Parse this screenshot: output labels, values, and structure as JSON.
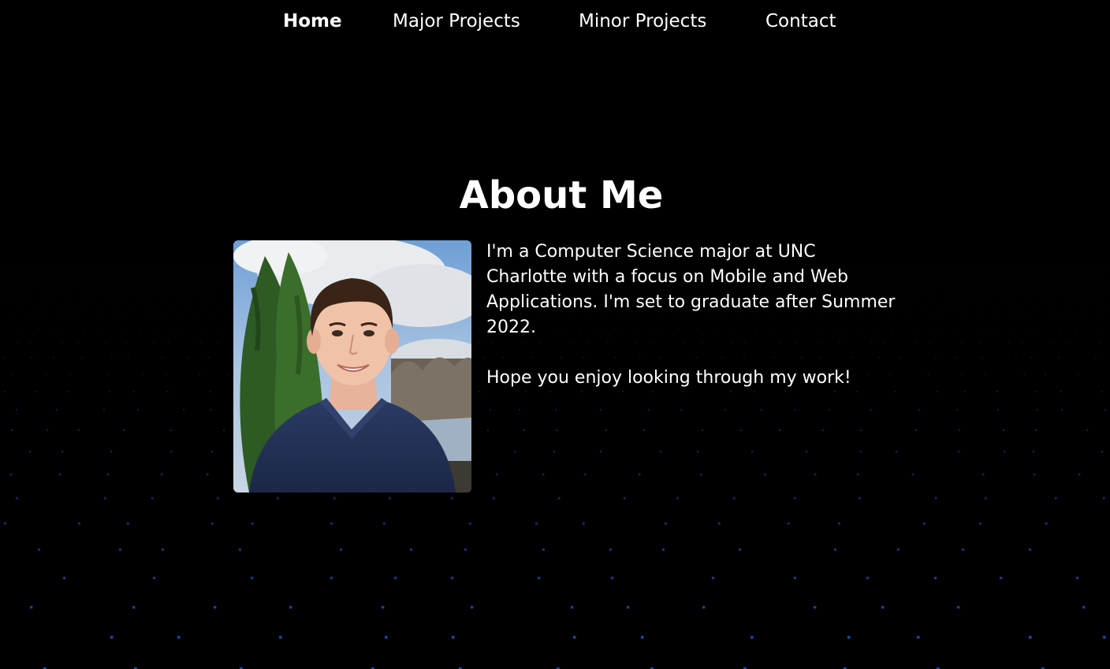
{
  "nav": {
    "items": [
      {
        "label": "Home",
        "active": true
      },
      {
        "label": "Major Projects",
        "active": false
      },
      {
        "label": "Minor Projects",
        "active": false
      },
      {
        "label": "Contact",
        "active": false
      }
    ]
  },
  "about": {
    "title": "About Me",
    "paragraphs": [
      "I'm a Computer Science major at UNC Charlotte with a focus on Mobile and Web Applications. I'm set to graduate after Summer 2022.",
      "Hope you enjoy looking through my work!"
    ]
  },
  "colors": {
    "background": "#000000",
    "text": "#ffffff",
    "dot_accent": "#2f5fd0"
  }
}
